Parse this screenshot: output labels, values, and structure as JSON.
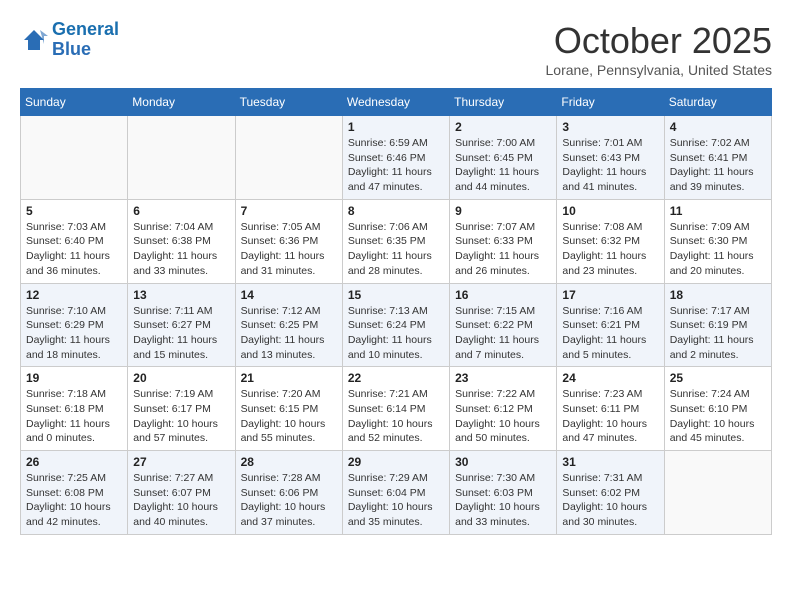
{
  "header": {
    "logo_line1": "General",
    "logo_line2": "Blue",
    "month": "October 2025",
    "location": "Lorane, Pennsylvania, United States"
  },
  "days_of_week": [
    "Sunday",
    "Monday",
    "Tuesday",
    "Wednesday",
    "Thursday",
    "Friday",
    "Saturday"
  ],
  "weeks": [
    [
      {
        "day": "",
        "info": ""
      },
      {
        "day": "",
        "info": ""
      },
      {
        "day": "",
        "info": ""
      },
      {
        "day": "1",
        "info": "Sunrise: 6:59 AM\nSunset: 6:46 PM\nDaylight: 11 hours and 47 minutes."
      },
      {
        "day": "2",
        "info": "Sunrise: 7:00 AM\nSunset: 6:45 PM\nDaylight: 11 hours and 44 minutes."
      },
      {
        "day": "3",
        "info": "Sunrise: 7:01 AM\nSunset: 6:43 PM\nDaylight: 11 hours and 41 minutes."
      },
      {
        "day": "4",
        "info": "Sunrise: 7:02 AM\nSunset: 6:41 PM\nDaylight: 11 hours and 39 minutes."
      }
    ],
    [
      {
        "day": "5",
        "info": "Sunrise: 7:03 AM\nSunset: 6:40 PM\nDaylight: 11 hours and 36 minutes."
      },
      {
        "day": "6",
        "info": "Sunrise: 7:04 AM\nSunset: 6:38 PM\nDaylight: 11 hours and 33 minutes."
      },
      {
        "day": "7",
        "info": "Sunrise: 7:05 AM\nSunset: 6:36 PM\nDaylight: 11 hours and 31 minutes."
      },
      {
        "day": "8",
        "info": "Sunrise: 7:06 AM\nSunset: 6:35 PM\nDaylight: 11 hours and 28 minutes."
      },
      {
        "day": "9",
        "info": "Sunrise: 7:07 AM\nSunset: 6:33 PM\nDaylight: 11 hours and 26 minutes."
      },
      {
        "day": "10",
        "info": "Sunrise: 7:08 AM\nSunset: 6:32 PM\nDaylight: 11 hours and 23 minutes."
      },
      {
        "day": "11",
        "info": "Sunrise: 7:09 AM\nSunset: 6:30 PM\nDaylight: 11 hours and 20 minutes."
      }
    ],
    [
      {
        "day": "12",
        "info": "Sunrise: 7:10 AM\nSunset: 6:29 PM\nDaylight: 11 hours and 18 minutes."
      },
      {
        "day": "13",
        "info": "Sunrise: 7:11 AM\nSunset: 6:27 PM\nDaylight: 11 hours and 15 minutes."
      },
      {
        "day": "14",
        "info": "Sunrise: 7:12 AM\nSunset: 6:25 PM\nDaylight: 11 hours and 13 minutes."
      },
      {
        "day": "15",
        "info": "Sunrise: 7:13 AM\nSunset: 6:24 PM\nDaylight: 11 hours and 10 minutes."
      },
      {
        "day": "16",
        "info": "Sunrise: 7:15 AM\nSunset: 6:22 PM\nDaylight: 11 hours and 7 minutes."
      },
      {
        "day": "17",
        "info": "Sunrise: 7:16 AM\nSunset: 6:21 PM\nDaylight: 11 hours and 5 minutes."
      },
      {
        "day": "18",
        "info": "Sunrise: 7:17 AM\nSunset: 6:19 PM\nDaylight: 11 hours and 2 minutes."
      }
    ],
    [
      {
        "day": "19",
        "info": "Sunrise: 7:18 AM\nSunset: 6:18 PM\nDaylight: 11 hours and 0 minutes."
      },
      {
        "day": "20",
        "info": "Sunrise: 7:19 AM\nSunset: 6:17 PM\nDaylight: 10 hours and 57 minutes."
      },
      {
        "day": "21",
        "info": "Sunrise: 7:20 AM\nSunset: 6:15 PM\nDaylight: 10 hours and 55 minutes."
      },
      {
        "day": "22",
        "info": "Sunrise: 7:21 AM\nSunset: 6:14 PM\nDaylight: 10 hours and 52 minutes."
      },
      {
        "day": "23",
        "info": "Sunrise: 7:22 AM\nSunset: 6:12 PM\nDaylight: 10 hours and 50 minutes."
      },
      {
        "day": "24",
        "info": "Sunrise: 7:23 AM\nSunset: 6:11 PM\nDaylight: 10 hours and 47 minutes."
      },
      {
        "day": "25",
        "info": "Sunrise: 7:24 AM\nSunset: 6:10 PM\nDaylight: 10 hours and 45 minutes."
      }
    ],
    [
      {
        "day": "26",
        "info": "Sunrise: 7:25 AM\nSunset: 6:08 PM\nDaylight: 10 hours and 42 minutes."
      },
      {
        "day": "27",
        "info": "Sunrise: 7:27 AM\nSunset: 6:07 PM\nDaylight: 10 hours and 40 minutes."
      },
      {
        "day": "28",
        "info": "Sunrise: 7:28 AM\nSunset: 6:06 PM\nDaylight: 10 hours and 37 minutes."
      },
      {
        "day": "29",
        "info": "Sunrise: 7:29 AM\nSunset: 6:04 PM\nDaylight: 10 hours and 35 minutes."
      },
      {
        "day": "30",
        "info": "Sunrise: 7:30 AM\nSunset: 6:03 PM\nDaylight: 10 hours and 33 minutes."
      },
      {
        "day": "31",
        "info": "Sunrise: 7:31 AM\nSunset: 6:02 PM\nDaylight: 10 hours and 30 minutes."
      },
      {
        "day": "",
        "info": ""
      }
    ]
  ]
}
